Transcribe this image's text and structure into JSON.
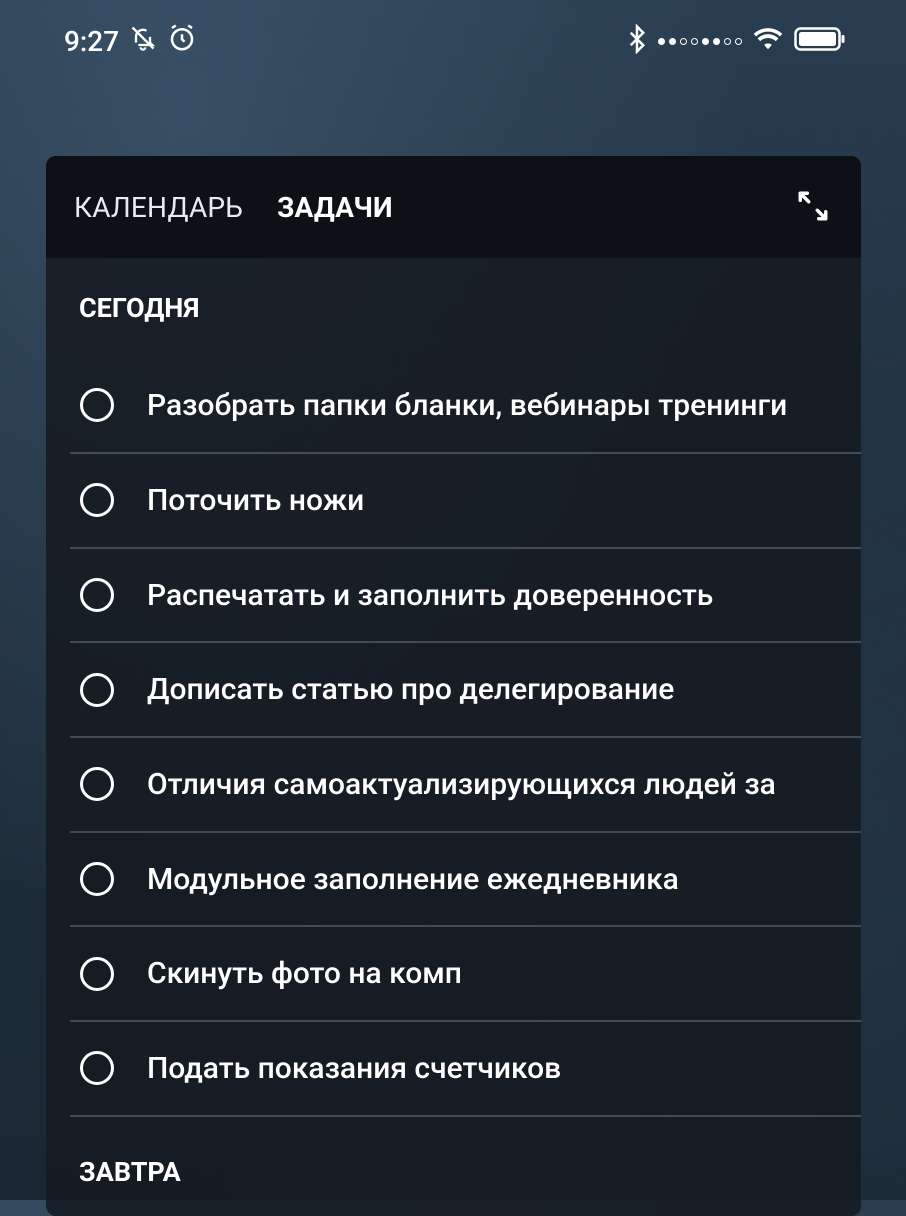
{
  "status_bar": {
    "time": "9:27",
    "left_icons": [
      "bell-muted-icon",
      "alarm-icon"
    ],
    "right_icons": [
      "bluetooth-icon",
      "signal-dots-icon",
      "wifi-icon",
      "battery-icon"
    ]
  },
  "widget": {
    "tabs": [
      {
        "label": "КАЛЕНДАРЬ",
        "active": false
      },
      {
        "label": "ЗАДАЧИ",
        "active": true
      }
    ],
    "expand_icon": "expand-icon",
    "sections": [
      {
        "title": "СЕГОДНЯ",
        "tasks": [
          {
            "text": "Разобрать папки бланки, вебинары тренинги",
            "done": false
          },
          {
            "text": "Поточить ножи",
            "done": false
          },
          {
            "text": "Распечатать и заполнить доверенность",
            "done": false
          },
          {
            "text": "Дописать статью про делегирование",
            "done": false
          },
          {
            "text": "Отличия самоактуализирующихся людей за",
            "done": false
          },
          {
            "text": "Модульное заполнение ежедневника",
            "done": false
          },
          {
            "text": "Скинуть фото на комп",
            "done": false
          },
          {
            "text": "Подать показания счетчиков",
            "done": false
          }
        ]
      },
      {
        "title": "ЗАВТРА",
        "tasks": []
      }
    ]
  },
  "colors": {
    "widget_bg": "#151a21",
    "header_bg": "#0c0f14",
    "divider": "#6b737c",
    "text": "#ffffff"
  }
}
